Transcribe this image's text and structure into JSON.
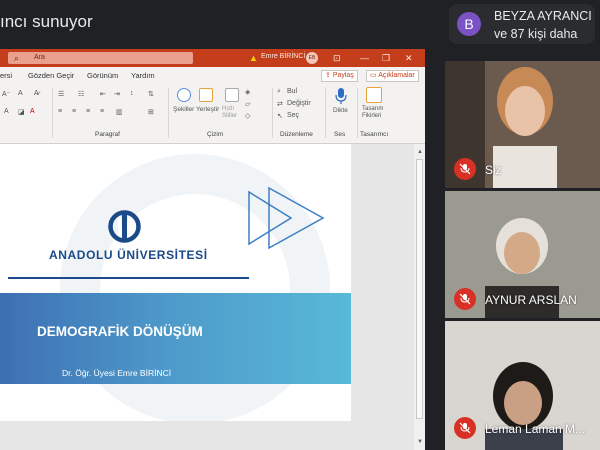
{
  "meeting": {
    "presenter_text": "ıncı sunuyor",
    "participants": {
      "avatar_letter": "B",
      "name": "BEYZA AYRANCI",
      "others": "ve 87 kişi daha"
    }
  },
  "powerpoint": {
    "search_placeholder": "Ara",
    "user_name": "Emre BİRİNCİ",
    "user_initials": "EB",
    "menu": [
      "ersi",
      "Gözden Geçir",
      "Görünüm",
      "Yardım"
    ],
    "share_label": "Paylaş",
    "comments_label": "Açıklamalar",
    "ribbon": {
      "groups": [
        "Paragraf",
        "Çizim",
        "Düzenleme",
        "Ses",
        "Tasarımcı"
      ],
      "shapes_label": "Şekiller",
      "arrange_label": "Yerleştir",
      "quick_styles_label": "Hızlı Stiller",
      "find_label": "Bul",
      "replace_label": "Değiştir",
      "select_label": "Seç",
      "dictate_label": "Dikte",
      "design_ideas_label": "Tasarım Fikirleri"
    },
    "slide": {
      "institution": "ANADOLU ÜNİVERSİTESİ",
      "title": "DEMOGRAFİK DÖNÜŞÜM",
      "author": "Dr. Öğr. Üyesi  Emre BİRİNCİ",
      "colors": {
        "brand_blue": "#1b4a89",
        "banner_start": "#3d6fb3",
        "banner_end": "#58b9d8"
      }
    },
    "colors": {
      "titlebar": "#c43e1c"
    }
  },
  "tiles": [
    {
      "name": "Siz",
      "muted": true
    },
    {
      "name": "AYNUR ARSLAN",
      "muted": true
    },
    {
      "name": "Leman Laman M...",
      "muted": true
    }
  ],
  "colors": {
    "mic_off_red": "#d93025",
    "avatar_purple": "#7b52c4"
  }
}
